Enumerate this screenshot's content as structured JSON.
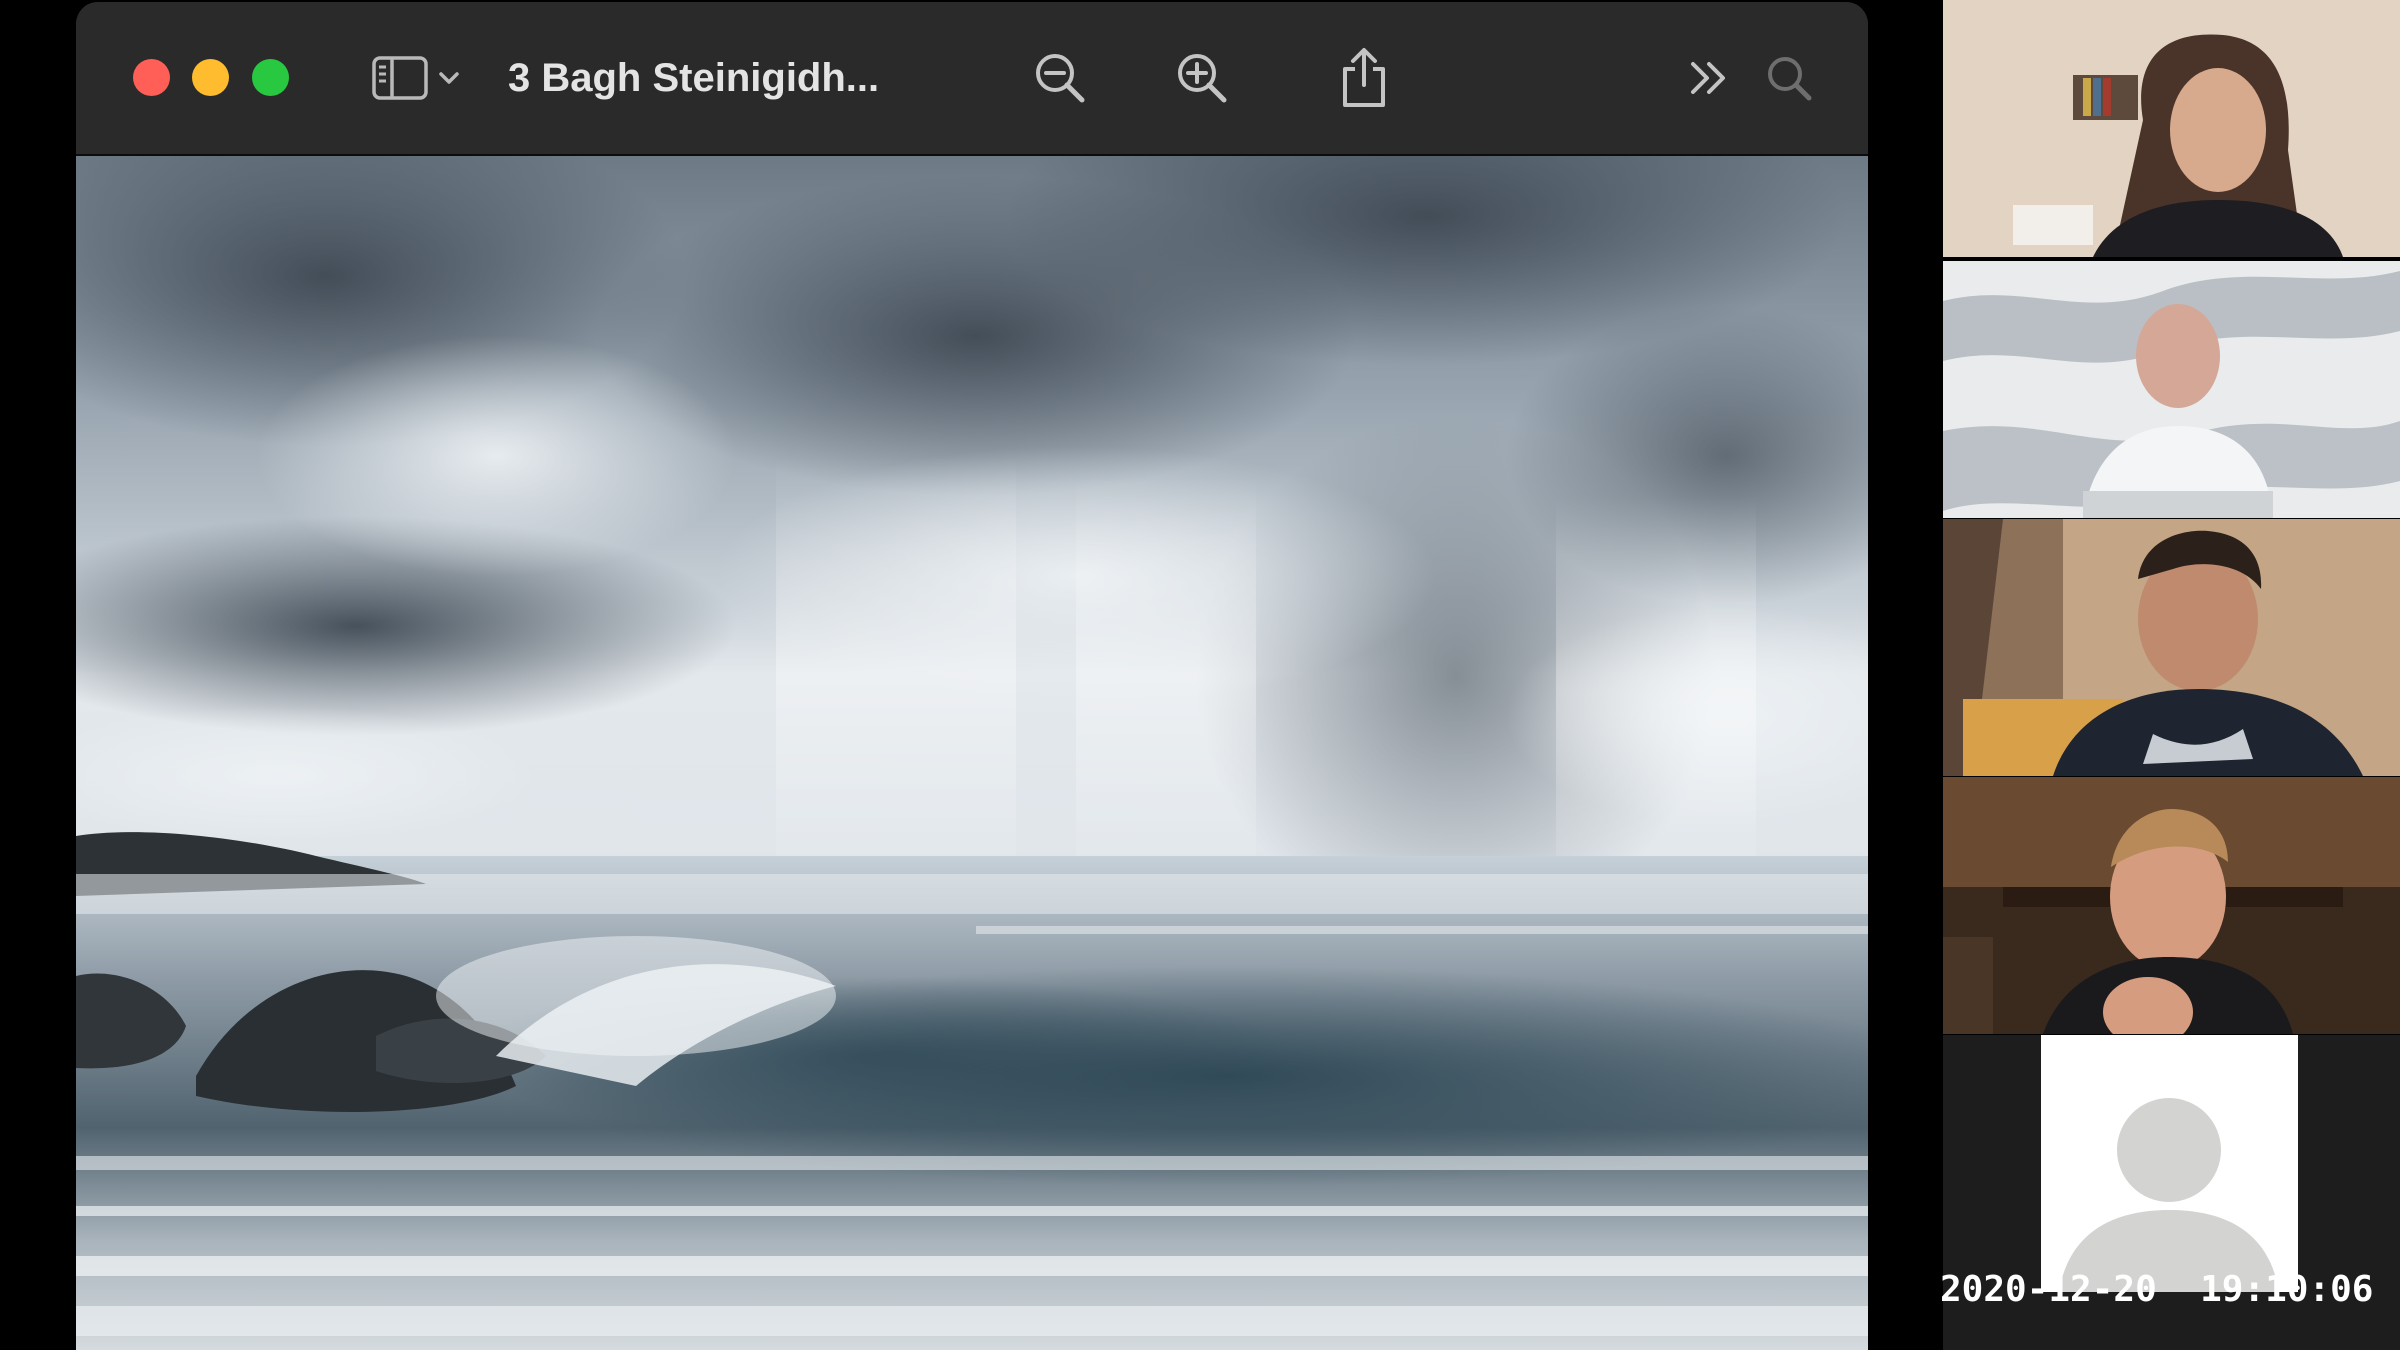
{
  "window": {
    "title": "3 Bagh Steinigidh...",
    "toolbar_icons": {
      "sidebar": "sidebar-icon",
      "sidebar_menu": "chevron-down-icon",
      "zoom_out": "zoom-out-icon",
      "zoom_in": "zoom-in-icon",
      "share": "share-icon",
      "more": "double-chevron-right-icon",
      "search": "search-icon"
    },
    "traffic_lights": {
      "close": "#ff5f57",
      "minimize": "#febc2e",
      "maximize": "#28c840"
    }
  },
  "image": {
    "subject": "stormy seascape with breaking wave"
  },
  "participants": [
    {
      "kind": "video"
    },
    {
      "kind": "video"
    },
    {
      "kind": "video"
    },
    {
      "kind": "video"
    },
    {
      "kind": "avatar-placeholder",
      "icon": "user-avatar-icon"
    }
  ],
  "overlay": {
    "timestamp": "2020-12-20  19:10:06"
  },
  "colors": {
    "titlebar": "#2b2a2b",
    "background": "#000000"
  }
}
